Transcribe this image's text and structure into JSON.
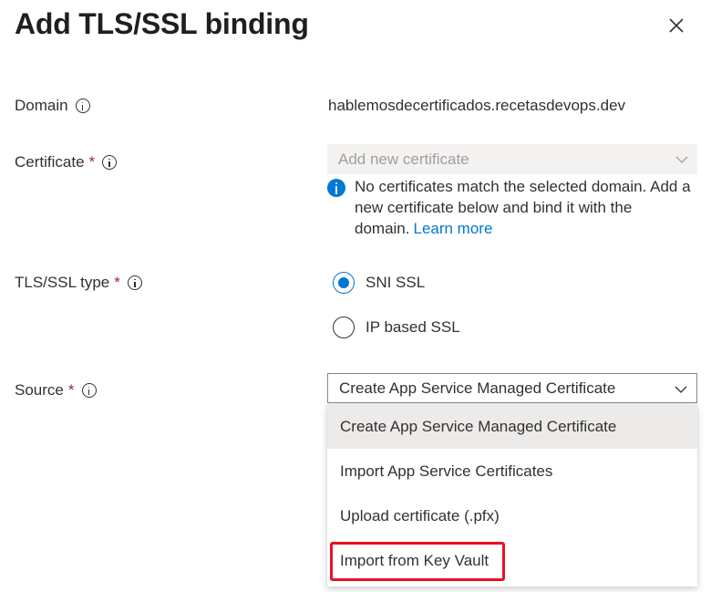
{
  "panel": {
    "title": "Add TLS/SSL binding",
    "close_icon": "close-icon"
  },
  "domain": {
    "label": "Domain",
    "value": "hablemosdecertificados.recetasdevops.dev"
  },
  "certificate": {
    "label": "Certificate",
    "required_mark": "*",
    "dropdown_value": "Add new certificate",
    "notice_text": "No certificates match the selected domain. Add a new certificate below and bind it with the domain.",
    "notice_link": "Learn more"
  },
  "tls_type": {
    "label": "TLS/SSL type",
    "required_mark": "*",
    "options": [
      {
        "label": "SNI SSL",
        "checked": true
      },
      {
        "label": "IP based SSL",
        "checked": false
      }
    ]
  },
  "source": {
    "label": "Source",
    "required_mark": "*",
    "selected": "Create App Service Managed Certificate",
    "options": [
      "Create App Service Managed Certificate",
      "Import App Service Certificates",
      "Upload certificate (.pfx)",
      "Import from Key Vault"
    ]
  },
  "colors": {
    "accent": "#0078d4",
    "required": "#a4262c",
    "highlight": "#e81123",
    "disabled_bg": "#f3f2f1"
  }
}
